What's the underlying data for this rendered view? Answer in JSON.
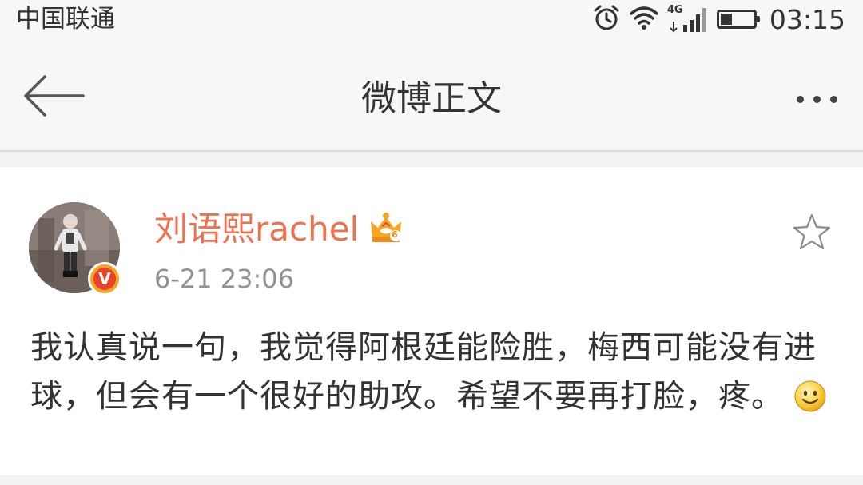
{
  "status_bar": {
    "carrier": "中国联通",
    "network": "4G",
    "time": "03:15",
    "battery_level": 0.35
  },
  "nav": {
    "title": "微博正文",
    "back_icon": "arrow-left-icon",
    "more_icon": "more-dots-icon"
  },
  "post": {
    "username": "刘语熙rachel",
    "timestamp": "6-21 23:06",
    "crown_level": "6",
    "verified_mark": "V",
    "text": "我认真说一句，我觉得阿根廷能险胜，梅西可能没有进球，但会有一个很好的助攻。希望不要再打脸，疼。",
    "emoji": "smile-emoji",
    "username_color": "#eb7350"
  }
}
